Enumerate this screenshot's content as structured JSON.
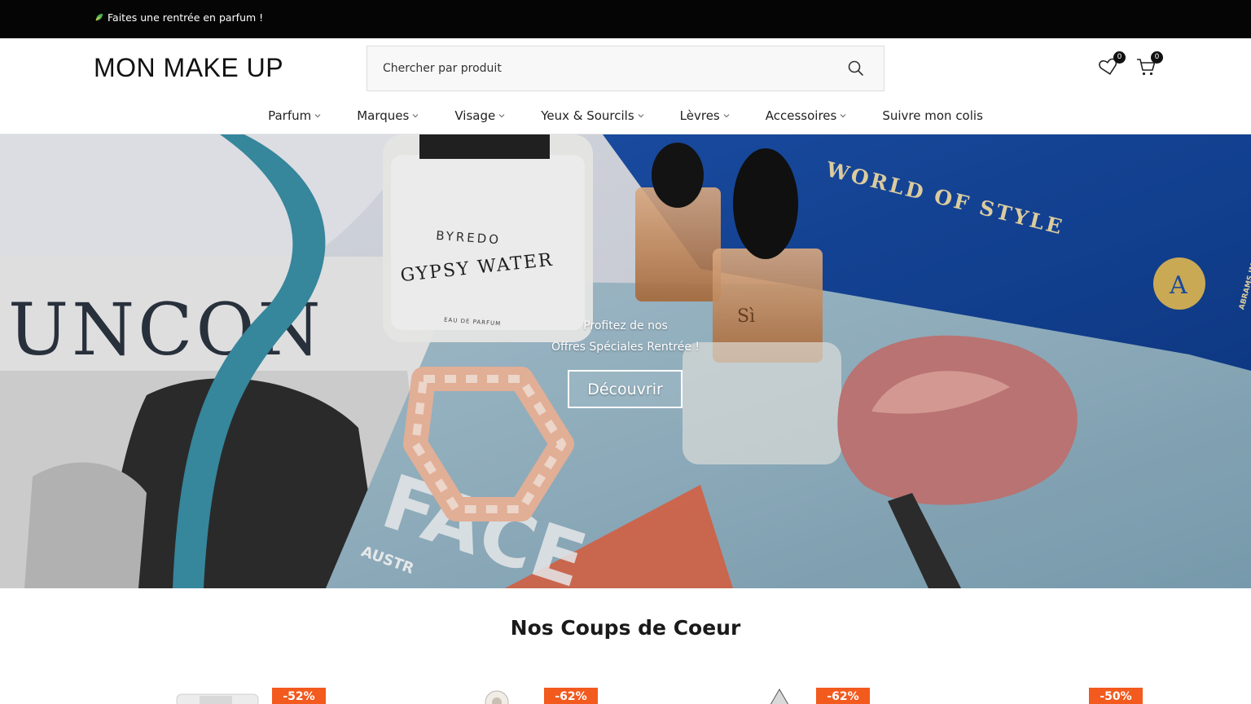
{
  "topbar": {
    "promo_text": "Faites une rentrée en parfum !",
    "promo_icon": "leaf-icon"
  },
  "header": {
    "logo": "MON MAKE UP",
    "search": {
      "placeholder": "Chercher par produit"
    },
    "wishlist_count": "0",
    "cart_count": "0"
  },
  "nav": {
    "items": [
      {
        "label": "Parfum",
        "has_dropdown": true
      },
      {
        "label": "Marques",
        "has_dropdown": true
      },
      {
        "label": "Visage",
        "has_dropdown": true
      },
      {
        "label": "Yeux & Sourcils",
        "has_dropdown": true
      },
      {
        "label": "Lèvres",
        "has_dropdown": true
      },
      {
        "label": "Accessoires",
        "has_dropdown": true
      },
      {
        "label": "Suivre mon colis",
        "has_dropdown": false
      }
    ]
  },
  "hero": {
    "caption_line1": "Profitez de nos",
    "caption_line2": "Offres Spéciales Rentrée !",
    "cta_label": "Découvrir",
    "photo_texts": {
      "magazine": "UNCON",
      "bottle_brand": "BYREDO",
      "bottle_name": "GYPSY WATER",
      "bottle_sub": "EAU DE PARFUM",
      "book_title": "WORLD OF STYLE",
      "bottle_mark": "Sì",
      "book_spine": "ABRAMS IMAGE",
      "seal_letter": "A",
      "mag_word": "FACE",
      "mag_sub": "AUSTR"
    }
  },
  "section": {
    "title": "Nos Coups de Coeur",
    "products": [
      {
        "discount": "-52%"
      },
      {
        "discount": "-62%"
      },
      {
        "discount": "-62%"
      },
      {
        "discount": "-50%"
      }
    ]
  },
  "colors": {
    "topbar_bg": "#050505",
    "badge": "#f25a1e"
  }
}
